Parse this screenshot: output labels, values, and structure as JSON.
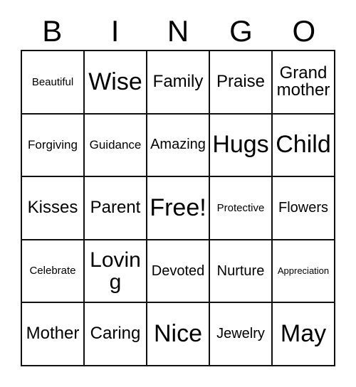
{
  "card": {
    "header_letters": [
      "B",
      "I",
      "N",
      "G",
      "O"
    ],
    "rows": [
      [
        {
          "label": "Beautiful",
          "size": "xs"
        },
        {
          "label": "Wise",
          "size": "xxl"
        },
        {
          "label": "Family",
          "size": "l"
        },
        {
          "label": "Praise",
          "size": "l"
        },
        {
          "label": "Grandmother",
          "size": "l",
          "wrap": true
        }
      ],
      [
        {
          "label": "Forgiving",
          "size": "s"
        },
        {
          "label": "Guidance",
          "size": "s"
        },
        {
          "label": "Amazing",
          "size": "m"
        },
        {
          "label": "Hugs",
          "size": "xxl"
        },
        {
          "label": "Child",
          "size": "xxl"
        }
      ],
      [
        {
          "label": "Kisses",
          "size": "l"
        },
        {
          "label": "Parent",
          "size": "l"
        },
        {
          "label": "Free!",
          "size": "xxl"
        },
        {
          "label": "Protective",
          "size": "xs"
        },
        {
          "label": "Flowers",
          "size": "m"
        }
      ],
      [
        {
          "label": "Celebrate",
          "size": "xs"
        },
        {
          "label": "Loving",
          "size": "xl"
        },
        {
          "label": "Devoted",
          "size": "m"
        },
        {
          "label": "Nurture",
          "size": "m"
        },
        {
          "label": "Appreciation",
          "size": "xxs"
        }
      ],
      [
        {
          "label": "Mother",
          "size": "l"
        },
        {
          "label": "Caring",
          "size": "l"
        },
        {
          "label": "Nice",
          "size": "xxl"
        },
        {
          "label": "Jewelry",
          "size": "m"
        },
        {
          "label": "May",
          "size": "xxl"
        }
      ]
    ],
    "colors": {
      "background": "#ffffff",
      "text": "#000000",
      "border": "#111111"
    }
  }
}
